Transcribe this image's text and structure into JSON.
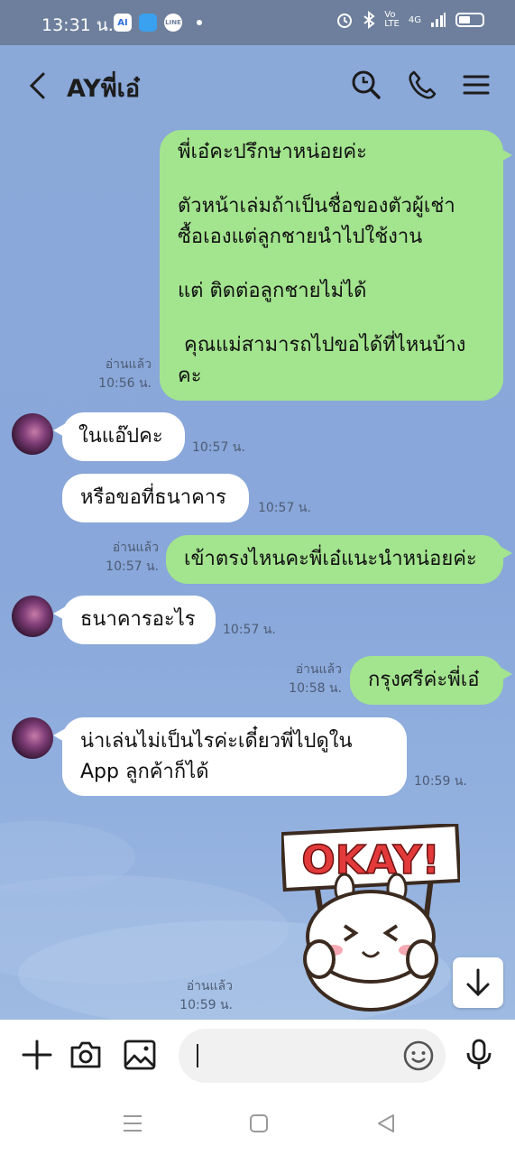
{
  "status_bar": {
    "time": "13:31 น.",
    "app_badges": [
      "AI",
      "",
      "LINE"
    ],
    "network": "4G"
  },
  "header": {
    "chat_title": "AYพี่เอ๋",
    "icons": [
      "back-icon",
      "search-icon",
      "phone-icon",
      "menu-icon"
    ]
  },
  "messages": {
    "m1": {
      "lines": [
        "พี่เอ๋คะปรึกษาหน่อยค่ะ",
        "",
        "ตัวหน้าเล่มถ้าเป็นชื่อของตัวผู้เช่า",
        "ซื้อเองแต่ลูกชายนำไปใช้งาน",
        "",
        "แต่ ติดต่อลูกชายไม่ได้",
        "",
        " คุณแม่สามารถไปขอได้ที่ไหนบ้าง",
        "คะ"
      ],
      "read": "อ่านแล้ว",
      "time": "10:56 น."
    },
    "m2": {
      "text": "ในแอ๊ปคะ",
      "time": "10:57 น."
    },
    "m3": {
      "text": "หรือขอที่ธนาคาร",
      "time": "10:57 น."
    },
    "m4": {
      "text": "เข้าตรงไหนคะพี่เอ๋แนะนำหน่อยค่ะ",
      "read": "อ่านแล้ว",
      "time": "10:57 น."
    },
    "m5": {
      "text": "ธนาคารอะไร",
      "time": "10:57 น."
    },
    "m6": {
      "text": "กรุงศรีค่ะพี่เอ๋",
      "read": "อ่านแล้ว",
      "time": "10:58 น."
    },
    "m7": {
      "lines": [
        "น่าเล่นไม่เป็นไรค่ะเดี๋ยวพี่ไปดูใน",
        "App ลูกค้าก็ได้"
      ],
      "time": "10:59 น."
    },
    "m8": {
      "sticker_text": "OKAY!",
      "read": "อ่านแล้ว",
      "time": "10:59 น."
    }
  },
  "input_bar": {
    "placeholder": "",
    "icons": [
      "plus-icon",
      "camera-icon",
      "image-icon",
      "emoji-icon",
      "microphone-icon"
    ]
  },
  "colors": {
    "chat_bg": "#8aa8d8",
    "my_bubble": "#a3e48e",
    "their_bubble": "#ffffff",
    "status_bar": "#6d7f9c"
  }
}
